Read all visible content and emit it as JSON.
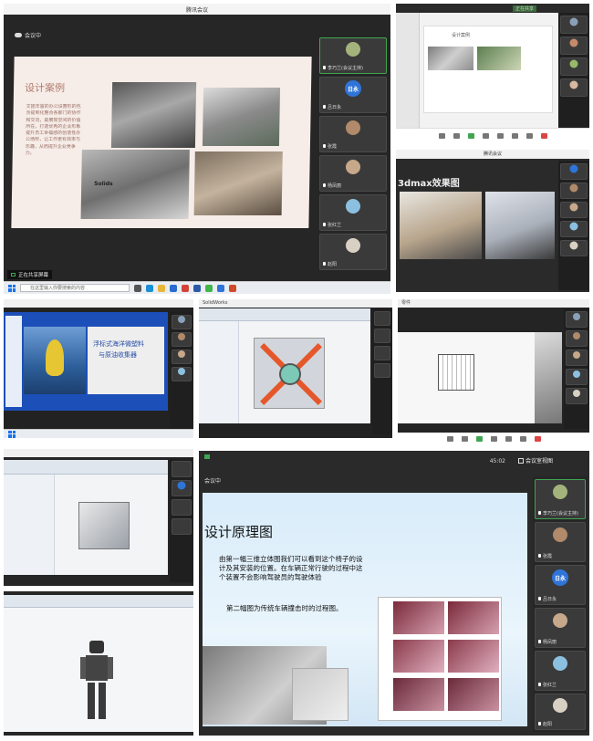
{
  "tile1": {
    "window_title": "腾讯会议",
    "status_text": "会议中",
    "slide_title": "设计案例",
    "slide_body": "文团丰富的办公设置形的包含提到化整合各部门的协作和交流，是展现空间的价值所在，打造优秀的企业形象提升员工幸福感的创造性办公场所，让工作更有效率与乐趣，从而提升企业竞争力。",
    "logo_text": "Solids",
    "share_label": "正在共享屏幕",
    "search_placeholder": "在这里输入你要搜索的内容",
    "participants": [
      {
        "name": "李巧兰(会议主持)",
        "avatar": "photo"
      },
      {
        "name": "吕日永",
        "avatar": "blue",
        "initials": "日永"
      },
      {
        "name": "张霞",
        "avatar": "photo"
      },
      {
        "name": "杨凤丽",
        "avatar": "photo"
      },
      {
        "name": "张红兰",
        "avatar": "photo"
      },
      {
        "name": "赵阳",
        "avatar": "photo"
      }
    ]
  },
  "tile2": {
    "slide_title": "设计案例",
    "tab_label": "正在共享"
  },
  "tile3": {
    "header": "腾讯会议",
    "slide_title": "3dmax效果图"
  },
  "tile4": {
    "title_line1": "浮标式海洋微塑料",
    "title_line2": "与原油收集器"
  },
  "tile5": {
    "label": "SolidWorks"
  },
  "tile6": {
    "label": "零件"
  },
  "tile9": {
    "status_text": "会议中",
    "top_right_button": "会议室视图",
    "top_right_count": "45:02",
    "slide_title": "设计原理图",
    "para1": "由第一幅三维立体图我们可以看到这个椅子的设计及其安装的位置。在车辆正常行驶的过程中这个装置不会影响驾驶员的驾驶体验",
    "para2": "第二幅图为传统车辆撞击时的过程图。",
    "participants": [
      {
        "name": "李巧兰(会议主持)",
        "avatar": "photo"
      },
      {
        "name": "张霞",
        "avatar": "photo"
      },
      {
        "name": "吕日永",
        "avatar": "blue",
        "initials": "日永"
      },
      {
        "name": "杨凤丽",
        "avatar": "photo"
      },
      {
        "name": "张红兰",
        "avatar": "photo"
      },
      {
        "name": "赵阳",
        "avatar": "photo"
      }
    ]
  }
}
